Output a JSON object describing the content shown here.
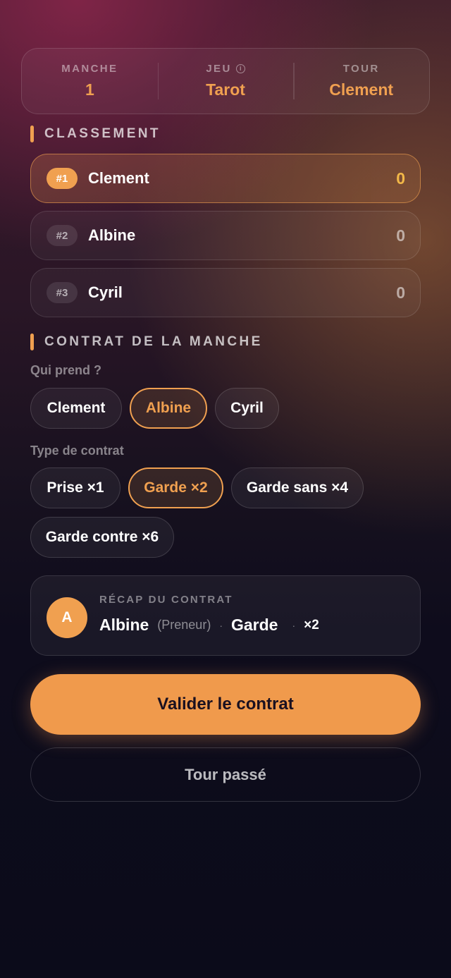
{
  "header": {
    "manche": {
      "label": "MANCHE",
      "value": "1"
    },
    "jeu": {
      "label": "JEU",
      "info_icon": "ⓘ",
      "value": "Tarot"
    },
    "tour": {
      "label": "TOUR",
      "value": "Clement"
    }
  },
  "classement": {
    "title": "CLASSEMENT",
    "rows": [
      {
        "rank": "#1",
        "name": "Clement",
        "score": "0"
      },
      {
        "rank": "#2",
        "name": "Albine",
        "score": "0"
      },
      {
        "rank": "#3",
        "name": "Cyril",
        "score": "0"
      }
    ]
  },
  "contrat": {
    "title": "CONTRAT DE LA MANCHE",
    "qui_prend_label": "Qui prend ?",
    "players": [
      "Clement",
      "Albine",
      "Cyril"
    ],
    "selected_player": "Albine",
    "type_label": "Type de contrat",
    "types": [
      "Prise ×1",
      "Garde ×2",
      "Garde sans ×4",
      "Garde contre ×6"
    ],
    "selected_type": "Garde ×2"
  },
  "recap": {
    "label": "RÉCAP DU CONTRAT",
    "avatar_letter": "A",
    "name": "Albine",
    "role": "(Preneur)",
    "separator": "·",
    "contract": "Garde",
    "multiplier": "×2"
  },
  "actions": {
    "validate_label": "Valider le contrat",
    "skip_label": "Tour passé"
  },
  "colors": {
    "accent": "#f0a050",
    "gold": "#f2b848",
    "background": "#0b0b1a"
  }
}
